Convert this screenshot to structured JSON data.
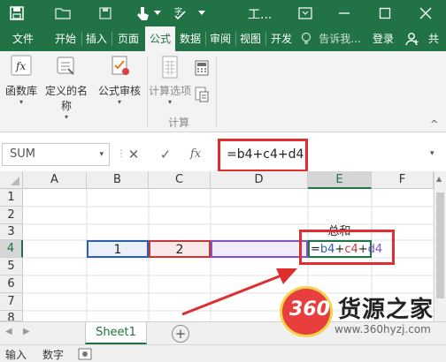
{
  "window": {
    "title": "工..."
  },
  "tabs": [
    {
      "label": "文件"
    },
    {
      "label": "开始"
    },
    {
      "label": "插入"
    },
    {
      "label": "页面"
    },
    {
      "label": "公式"
    },
    {
      "label": "数据"
    },
    {
      "label": "审阅"
    },
    {
      "label": "视图"
    },
    {
      "label": "开发"
    },
    {
      "label": "告诉我..."
    },
    {
      "label": "登录"
    }
  ],
  "ribbon": {
    "function_library": "函数库",
    "defined_names": "定义的名称",
    "formula_auditing": "公式审核",
    "calc_options": "计算选项",
    "calc_group": "计算"
  },
  "formula_bar": {
    "name_box": "SUM",
    "formula": "=b4+c4+d4",
    "fx": "fx"
  },
  "columns": [
    "A",
    "B",
    "C",
    "D",
    "E",
    "F"
  ],
  "rows": [
    "1",
    "2",
    "3",
    "4",
    "5",
    "6",
    "7",
    "8"
  ],
  "cells": {
    "B4": "1",
    "C4": "2",
    "E3": "总和",
    "E4_eq": "=",
    "E4_b4": "b4",
    "E4_p1": "+",
    "E4_c4": "c4",
    "E4_p2": "+",
    "E4_d4": "d4"
  },
  "sheets": [
    {
      "label": "Sheet1"
    }
  ],
  "status": {
    "mode": "输入",
    "numeric": "数字"
  },
  "watermark": {
    "logo_number": "360",
    "logo_text": "货源之家",
    "url": "www.360hyzj.com"
  },
  "colors": {
    "accent": "#217346",
    "annotation": "#e02d2d",
    "ref_b4": "#2f5fa8",
    "ref_c4": "#c0393b",
    "ref_d4": "#7f56c2"
  }
}
